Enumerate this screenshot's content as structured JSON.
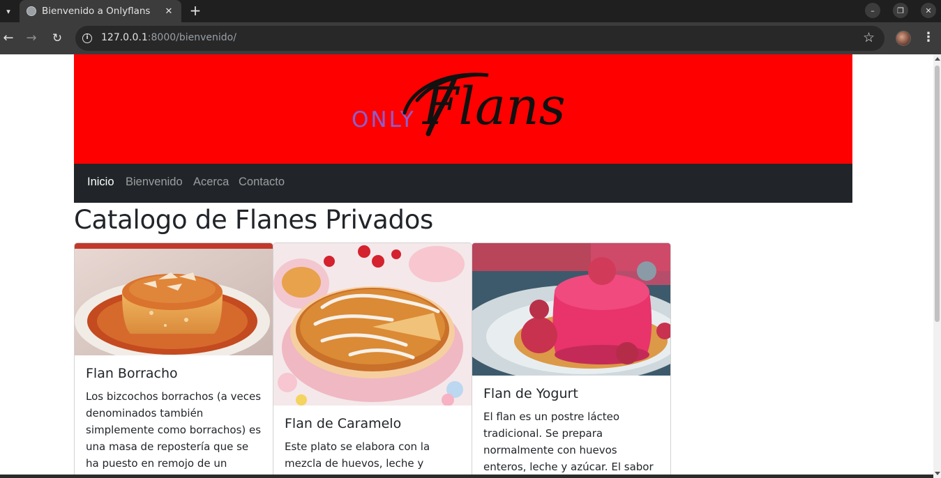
{
  "browser": {
    "tab_title": "Bienvenido a Onlyflans",
    "tab_close": "✕",
    "new_tab": "+",
    "url_host": "127.0.0.1",
    "url_path": ":8000/bienvenido/",
    "window_buttons": {
      "minimize": "–",
      "restore": "❐",
      "close": "✕"
    }
  },
  "hero": {
    "logo_prefix": "ONLY",
    "logo_script": "Flans",
    "background_color": "#ff0000",
    "prefix_color": "#8a5fd0"
  },
  "navbar": {
    "items": [
      {
        "label": "Inicio",
        "active": true
      },
      {
        "label": "Bienvenido",
        "active": false
      },
      {
        "label": "Acerca",
        "active": false
      },
      {
        "label": "Contacto",
        "active": false
      }
    ],
    "background_color": "#212529"
  },
  "main": {
    "title": "Catalogo de Flanes Privados",
    "cards": [
      {
        "title": "Flan Borracho",
        "text": "Los bizcochos borrachos (a veces denominados también simplemente como borrachos) es una masa de repostería que se ha puesto en remojo de un almíbar"
      },
      {
        "title": "Flan de Caramelo",
        "text": "Este plato se elabora con la mezcla de huevos, leche y azúcar, la cual"
      },
      {
        "title": "Flan de Yogurt",
        "text": "El flan es un postre lácteo tradicional. Se prepara normalmente con huevos enteros, leche y azúcar. El sabor más común"
      }
    ]
  }
}
